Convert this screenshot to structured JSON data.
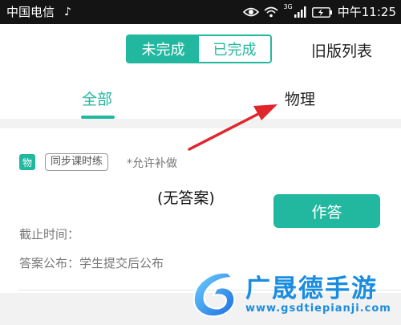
{
  "status_bar": {
    "carrier": "中国电信",
    "network": "3G",
    "time": "中午11:25"
  },
  "header": {
    "segment_unfinished": "未完成",
    "segment_finished": "已完成",
    "old_list_link": "旧版列表"
  },
  "tabs": {
    "all": "全部",
    "physics": "物理"
  },
  "assignment": {
    "subject_badge": "物",
    "type_tag": "同步课时练",
    "allow_late": "*允许补做",
    "answer_status": "(无答案)",
    "answer_button": "作答",
    "deadline_label": "截止时间：",
    "publish_info": "答案公布：学生提交后公布"
  },
  "watermark": {
    "title": "广晟德手游",
    "url": "www.gsdtiepianji.com"
  },
  "colors": {
    "accent": "#22b8a0",
    "arrow": "#e0262b",
    "watermark": "#1b8de0"
  }
}
